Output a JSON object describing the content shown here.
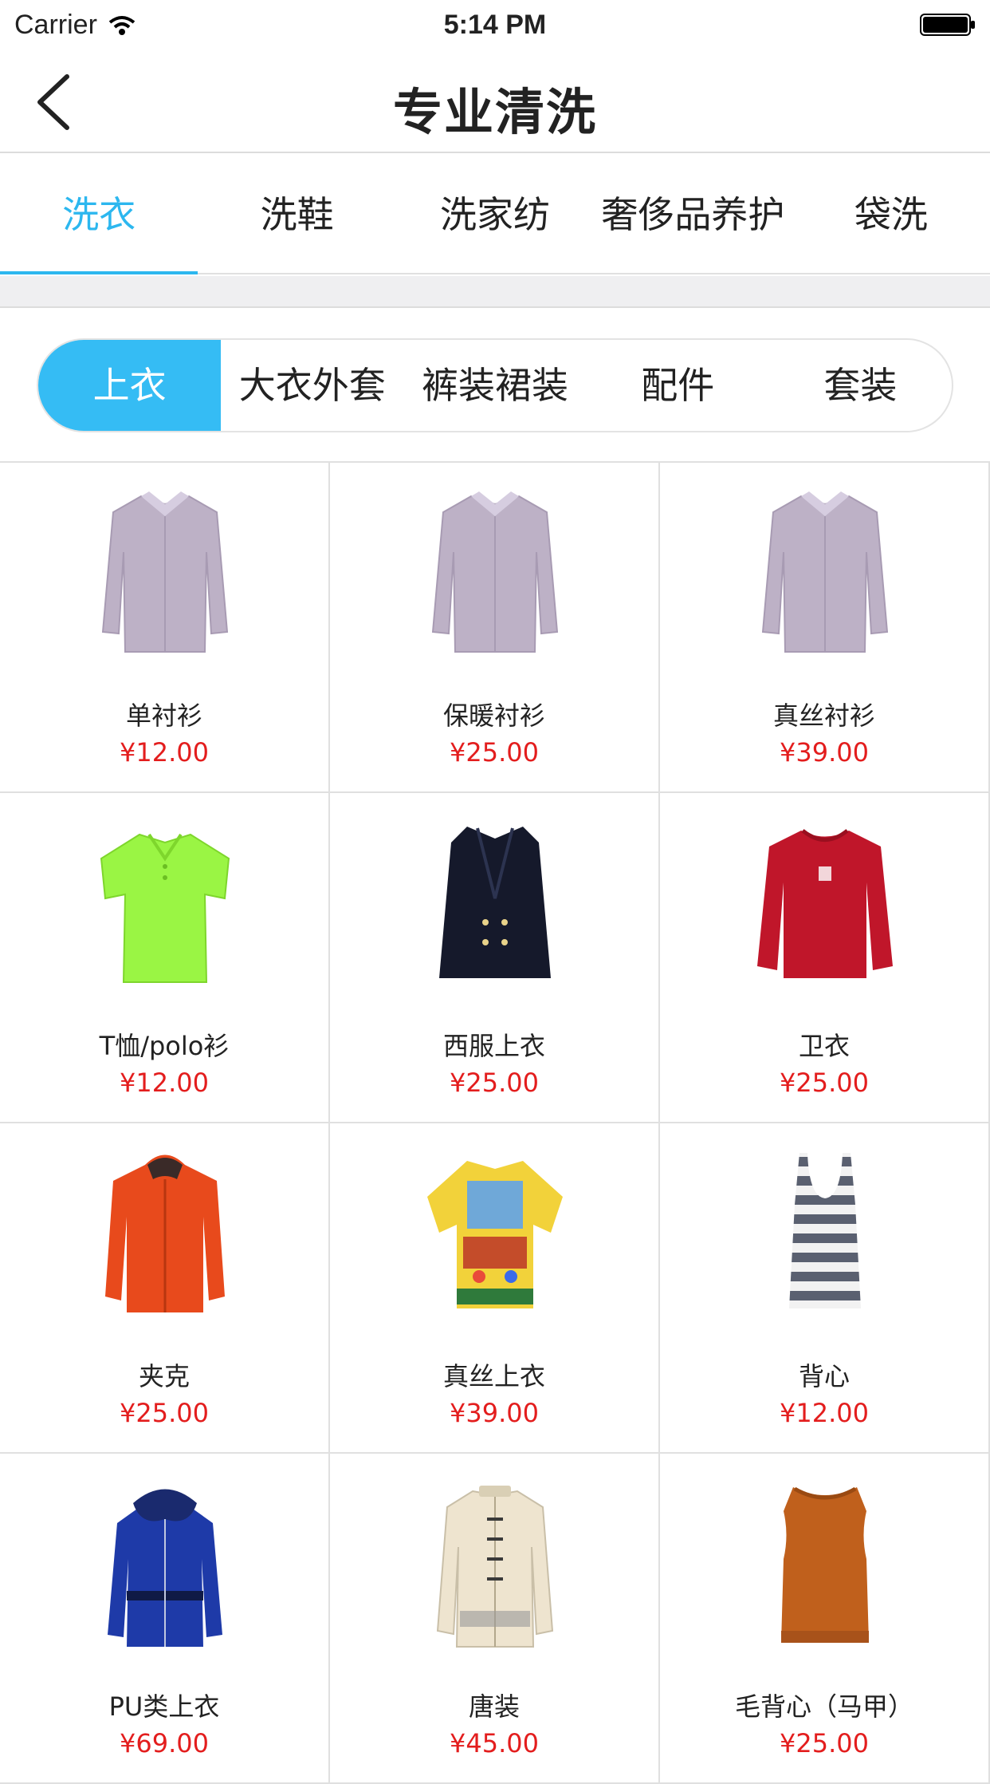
{
  "status_bar": {
    "carrier": "Carrier",
    "time": "5:14 PM"
  },
  "nav": {
    "title": "专业清洗"
  },
  "tabs": [
    {
      "label": "洗衣",
      "active": true
    },
    {
      "label": "洗鞋",
      "active": false
    },
    {
      "label": "洗家纺",
      "active": false
    },
    {
      "label": "奢侈品养护",
      "active": false
    },
    {
      "label": "袋洗",
      "active": false
    }
  ],
  "segments": [
    {
      "label": "上衣",
      "active": true
    },
    {
      "label": "大衣外套",
      "active": false
    },
    {
      "label": "裤装裙装",
      "active": false
    },
    {
      "label": "配件",
      "active": false
    },
    {
      "label": "套装",
      "active": false
    }
  ],
  "products": [
    {
      "name": "单衬衫",
      "price": "¥12.00",
      "icon": "dress-shirt-icon"
    },
    {
      "name": "保暖衬衫",
      "price": "¥25.00",
      "icon": "dress-shirt-icon"
    },
    {
      "name": "真丝衬衫",
      "price": "¥39.00",
      "icon": "dress-shirt-icon"
    },
    {
      "name": "T恤/polo衫",
      "price": "¥12.00",
      "icon": "polo-shirt-icon"
    },
    {
      "name": "西服上衣",
      "price": "¥25.00",
      "icon": "suit-jacket-icon"
    },
    {
      "name": "卫衣",
      "price": "¥25.00",
      "icon": "sweatshirt-icon"
    },
    {
      "name": "夹克",
      "price": "¥25.00",
      "icon": "jacket-icon"
    },
    {
      "name": "真丝上衣",
      "price": "¥39.00",
      "icon": "silk-top-icon"
    },
    {
      "name": "背心",
      "price": "¥12.00",
      "icon": "tank-top-icon"
    },
    {
      "name": "PU类上衣",
      "price": "¥69.00",
      "icon": "leather-jacket-icon"
    },
    {
      "name": "唐装",
      "price": "¥45.00",
      "icon": "tang-suit-icon"
    },
    {
      "name": "毛背心（马甲）",
      "price": "¥25.00",
      "icon": "sweater-vest-icon"
    }
  ],
  "colors": {
    "accent": "#2cb7ef",
    "price": "#e31d1d",
    "shirt": "#bdb1c6",
    "polo": "#9af544",
    "suit": "#15192b",
    "sweatshirt": "#c0162a",
    "jacket": "#e84a1c",
    "leather": "#1e3aa8",
    "tang": "#eee4cf",
    "vest": "#c0601c"
  }
}
